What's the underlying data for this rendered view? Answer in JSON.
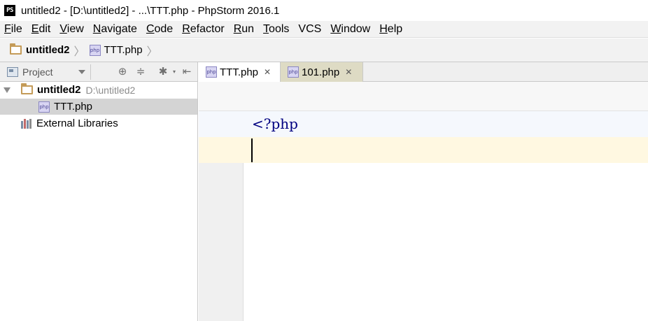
{
  "window": {
    "app_icon_text": "PS",
    "title": "untitled2 - [D:\\untitled2] - ...\\TTT.php - PhpStorm 2016.1"
  },
  "menu": [
    {
      "mnemonic": "F",
      "rest": "ile"
    },
    {
      "mnemonic": "E",
      "rest": "dit"
    },
    {
      "mnemonic": "V",
      "rest": "iew"
    },
    {
      "mnemonic": "N",
      "rest": "avigate"
    },
    {
      "mnemonic": "C",
      "rest": "ode"
    },
    {
      "mnemonic": "R",
      "rest": "efactor"
    },
    {
      "mnemonic": "R",
      "rest": "un",
      "prefix": ""
    },
    {
      "mnemonic": "T",
      "rest": "ools"
    },
    {
      "mnemonic": "",
      "rest": "VCS"
    },
    {
      "mnemonic": "W",
      "rest": "indow"
    },
    {
      "mnemonic": "H",
      "rest": "elp"
    }
  ],
  "navbar": {
    "project": "untitled2",
    "separator": "〉",
    "file": "TTT.php"
  },
  "project_panel": {
    "label": "Project",
    "tree": {
      "root_name": "untitled2",
      "root_path": "D:\\untitled2",
      "file": "TTT.php",
      "libraries": "External Libraries"
    }
  },
  "icons": {
    "php_badge": "php",
    "locate": "⊕",
    "collapse": "≑",
    "settings": "✱",
    "hide": "⇤",
    "close": "✕"
  },
  "tabs": [
    {
      "label": "TTT.php",
      "active": true
    },
    {
      "label": "101.php",
      "active": false
    }
  ],
  "editor": {
    "line1": "<?php",
    "line2": ""
  },
  "colors": {
    "php_keyword": "#000080",
    "current_line": "#fff8e1",
    "inactive_tab": "#dedbc4",
    "folder": "#c49b58"
  }
}
